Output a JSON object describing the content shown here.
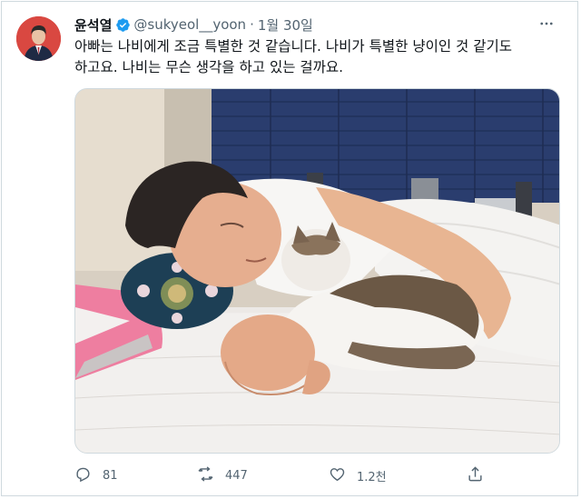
{
  "tweet": {
    "author": {
      "name": "윤석열",
      "handle": "@sukyeol__yoon",
      "verified": true
    },
    "separator": "·",
    "date": "1월 30일",
    "text": "아빠는 나비에게 조금 특별한 것 같습니다. 나비가 특별한 냥이인 것 같기도\n하고요. 나비는 무슨 생각을 하고 있는 걸까요.",
    "media_icon": "photo-of-man-lying-in-bed-with-tabby-white-cat",
    "actions": {
      "replies": "81",
      "retweets": "447",
      "likes": "1.2천"
    },
    "icons": {
      "more": "more-horizontal-icon",
      "reply": "reply-icon",
      "retweet": "retweet-icon",
      "like": "heart-icon",
      "share": "share-icon"
    },
    "colors": {
      "verified": "#1d9bf0",
      "secondary_text": "#536471",
      "border": "#cfd9de"
    }
  }
}
